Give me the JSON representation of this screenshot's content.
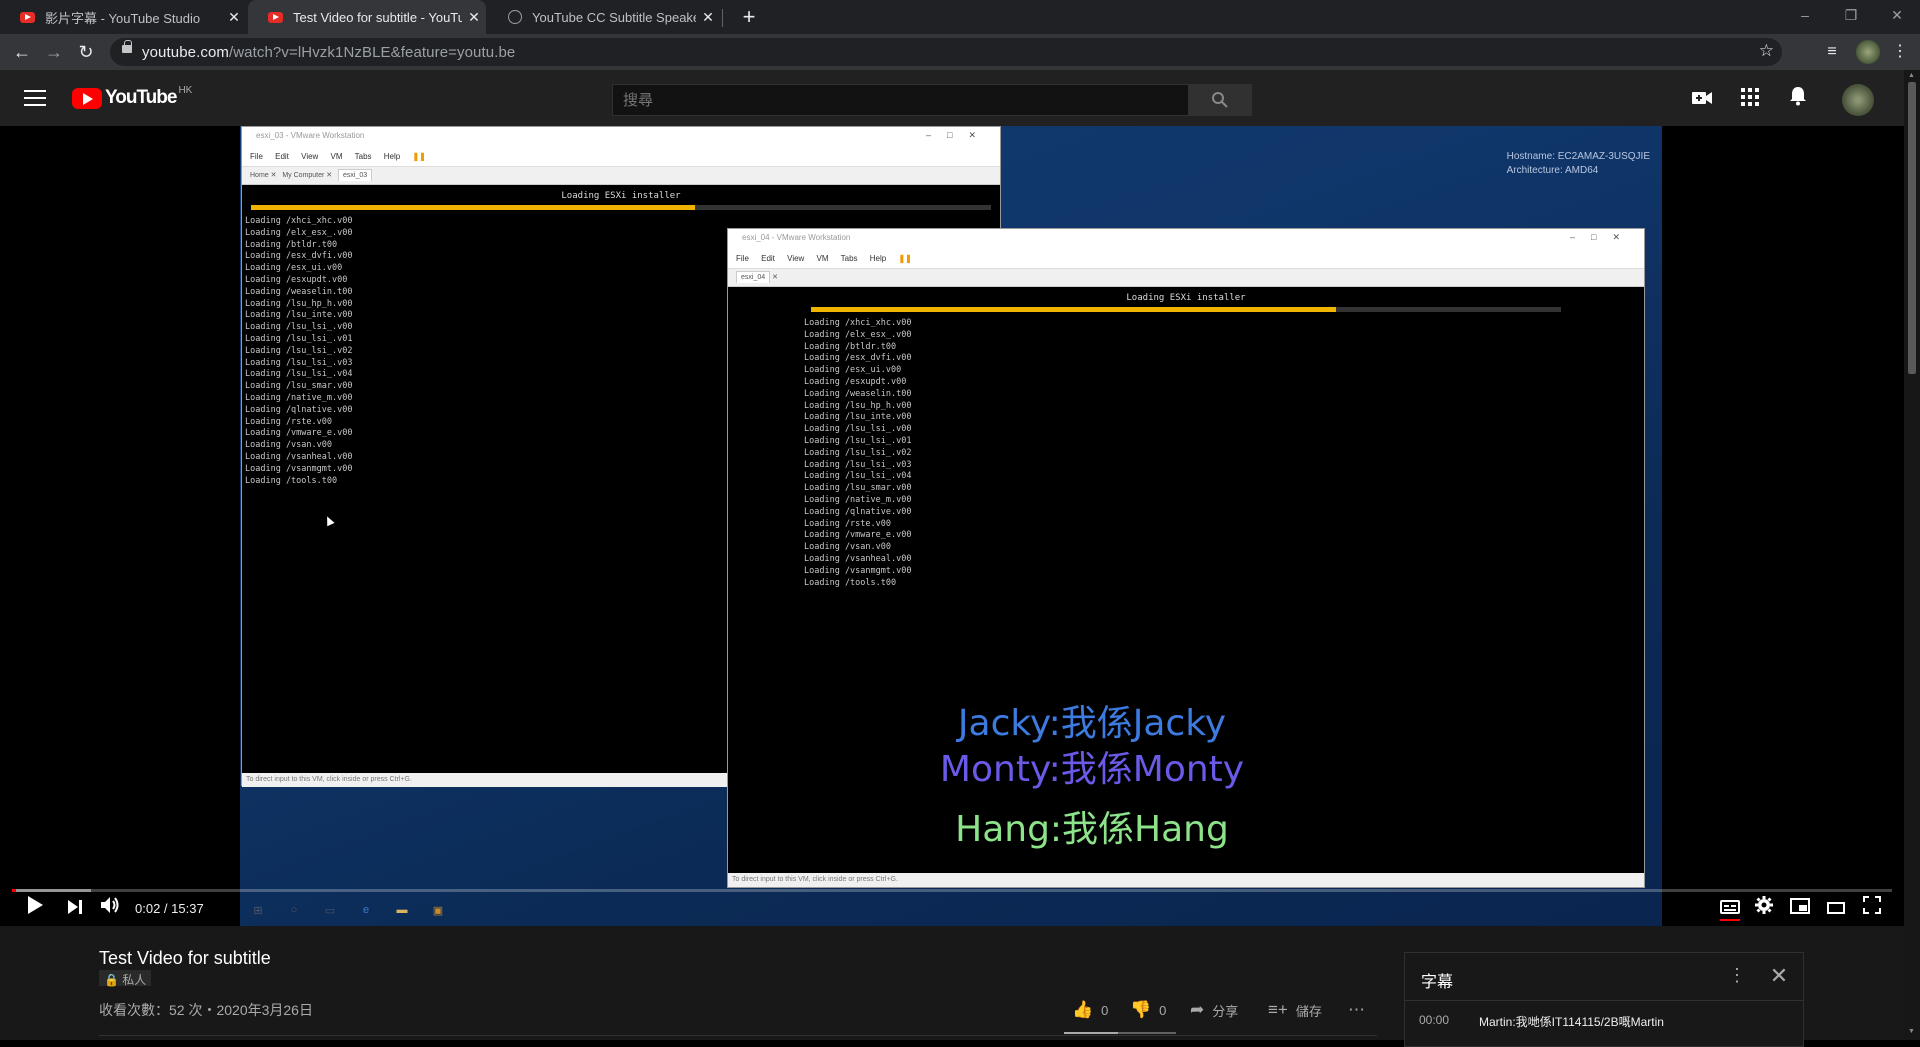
{
  "browser": {
    "tabs": [
      {
        "title": "影片字幕 - YouTube Studio",
        "close": "✕"
      },
      {
        "title": "Test Video for subtitle - YouTube",
        "close": "✕"
      },
      {
        "title": "YouTube CC Subtitle Speaker C",
        "close": "✕"
      }
    ],
    "new_tab": "+",
    "url_host": "youtube.com",
    "url_rest": "/watch?v=lHvzk1NzBLE&feature=youtu.be"
  },
  "youtube": {
    "logo_word": "YouTube",
    "country_code": "HK",
    "search_placeholder": "搜尋"
  },
  "player": {
    "desktop_info": [
      "Hostname: EC2AMAZ-3USQJIE",
      "Architecture: AMD64"
    ],
    "vm1": {
      "title": "esxi_03 - VMware Workstation",
      "menu": "File Edit View VM Tabs Help",
      "tabs": [
        "Home",
        "My Computer",
        "esxi_03"
      ],
      "header": "Loading ESXi installer",
      "progress": 0.6,
      "log": "Loading /xhci_xhc.v00\nLoading /elx_esx_.v00\nLoading /btldr.t00\nLoading /esx_dvfi.v00\nLoading /esx_ui.v00\nLoading /esxupdt.v00\nLoading /weaselin.t00\nLoading /lsu_hp_h.v00\nLoading /lsu_inte.v00\nLoading /lsu_lsi_.v00\nLoading /lsu_lsi_.v01\nLoading /lsu_lsi_.v02\nLoading /lsu_lsi_.v03\nLoading /lsu_lsi_.v04\nLoading /lsu_smar.v00\nLoading /native_m.v00\nLoading /qlnative.v00\nLoading /rste.v00\nLoading /vmware_e.v00\nLoading /vsan.v00\nLoading /vsanheal.v00\nLoading /vsanmgmt.v00\nLoading /tools.t00",
      "status": "To direct input to this VM, click inside or press Ctrl+G."
    },
    "vm2": {
      "title": "esxi_04 - VMware Workstation",
      "menu": "File Edit View VM Tabs Help",
      "tabs": [
        "esxi_04"
      ],
      "header": "Loading ESXi installer",
      "progress": 0.7,
      "log": "Loading /xhci_xhc.v00\nLoading /elx_esx_.v00\nLoading /btldr.t00\nLoading /esx_dvfi.v00\nLoading /esx_ui.v00\nLoading /esxupdt.v00\nLoading /weaselin.t00\nLoading /lsu_hp_h.v00\nLoading /lsu_inte.v00\nLoading /lsu_lsi_.v00\nLoading /lsu_lsi_.v01\nLoading /lsu_lsi_.v02\nLoading /lsu_lsi_.v03\nLoading /lsu_lsi_.v04\nLoading /lsu_smar.v00\nLoading /native_m.v00\nLoading /qlnative.v00\nLoading /rste.v00\nLoading /vmware_e.v00\nLoading /vsan.v00\nLoading /vsanheal.v00\nLoading /vsanmgmt.v00\nLoading /tools.t00",
      "status": "To direct input to this VM, click inside or press Ctrl+G."
    },
    "captions": [
      {
        "text": "Jacky:我係Jacky",
        "color": "#3d7be0"
      },
      {
        "text": "Monty:我係Monty",
        "color": "#6a5ae8"
      },
      {
        "text": "Hang:我係Hang",
        "color": "#8de38a"
      }
    ],
    "time": "0:02 / 15:37",
    "progress_played": 0.002,
    "progress_loaded": 0.042
  },
  "video": {
    "title": "Test Video for subtitle",
    "privacy": "私人",
    "meta": "收看次數：52 次・2020年3月26日",
    "likes": "0",
    "dislikes": "0",
    "share": "分享",
    "save": "儲存"
  },
  "transcript": {
    "title": "字幕",
    "time": "00:00",
    "text": "Martin:我哋係IT114115/2B嘅Martin"
  },
  "colors": {
    "accent": "#ff0000",
    "background": "#181818"
  }
}
